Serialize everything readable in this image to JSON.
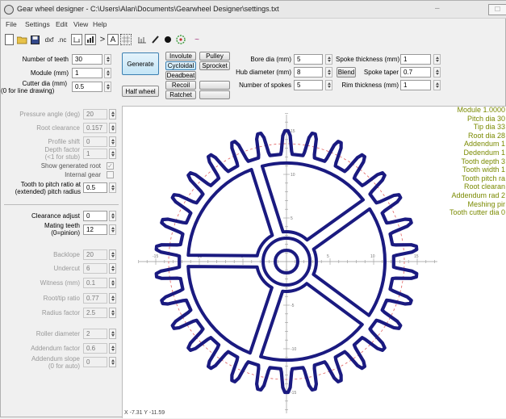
{
  "window": {
    "title": "Gear wheel designer - C:\\Users\\Alan\\Documents\\Gearwheel Designer\\settings.txt",
    "minimize": "–",
    "maximize": "□"
  },
  "menu": [
    "File",
    "Settings",
    "Edit",
    "View",
    "Help"
  ],
  "toolbar": {
    "dxf": "dxf",
    "nc": ".nc",
    "inv_tool": "A",
    "chart_icon": "~"
  },
  "top_left": {
    "teeth_label": "Number of teeth",
    "teeth_value": "30",
    "module_label": "Module (mm)",
    "module_value": "1",
    "cutter_label": "Cutter dia (mm)",
    "cutter_sub": "(0 for line drawing)",
    "cutter_value": "0.5"
  },
  "buttons": {
    "generate": "Generate",
    "half_wheel": "Half wheel",
    "involute": "Involute",
    "cycloidal": "Cycloidal",
    "deadbeat": "Deadbeat",
    "recoil": "Recoil",
    "ratchet": "Ratchet",
    "pulley": "Pulley",
    "sprocket": "Sprocket",
    "blend": "Blend"
  },
  "hub": {
    "bore_label": "Bore dia (mm)",
    "bore_value": "5",
    "hub_label": "Hub diameter (mm)",
    "hub_value": "8",
    "spokes_label": "Number of spokes",
    "spokes_value": "5",
    "spoke_thick_label": "Spoke thickness (mm)",
    "spoke_thick_value": "1",
    "spoke_taper_label": "Spoke taper",
    "spoke_taper_value": "0.7",
    "rim_label": "Rim thickness (mm)",
    "rim_value": "1"
  },
  "left_panel": {
    "pressure_label": "Pressure angle (deg)",
    "pressure_value": "20",
    "root_clear_label": "Root clearance",
    "root_clear_value": "0.157",
    "profile_label": "Profile shift",
    "profile_value": "0",
    "depth_label": "Depth factor",
    "depth_sub": "(<1 for stub)",
    "depth_value": "1",
    "show_root_label": "Show generated root",
    "internal_label": "Internal gear",
    "ratio_label": "Tooth to pitch ratio at",
    "ratio_sub": "(extended) pitch radius",
    "ratio_value": "0.5",
    "clearance_label": "Clearance adjust",
    "clearance_value": "0",
    "mating_label": "Mating teeth",
    "mating_sub": "(0=pinion)",
    "mating_value": "12",
    "backlope_label": "Backlope",
    "backlope_value": "20",
    "undercut_label": "Undercut",
    "undercut_value": "6",
    "witness_label": "Witness (mm)",
    "witness_value": "0.1",
    "roottip_label": "Root/tip ratio",
    "roottip_value": "0.77",
    "radius_label": "Radius factor",
    "radius_value": "2.5",
    "roller_label": "Roller diameter",
    "roller_value": "2",
    "addendum_factor_label": "Addendum factor",
    "addendum_factor_value": "0.6",
    "addendum_slope_label": "Addendum slope",
    "addendum_slope_sub": "(0 for auto)",
    "addendum_slope_value": "0"
  },
  "info_lines": [
    "Module 1.0000",
    "Pitch dia 30",
    "Tip dia 33",
    "Root dia 28",
    "Addendum 1",
    "Dedendum 1",
    "Tooth depth 3",
    "Tooth width 1",
    "Tooth pitch ra",
    "Root clearan",
    "Addendum rad 2",
    "Meshing pir",
    "Tooth cutter dia 0"
  ],
  "axis_ticks": {
    "x": [
      "-15",
      "-10",
      "-5",
      "5",
      "10",
      "15"
    ],
    "y": [
      "15",
      "10",
      "5",
      "-5",
      "-10",
      "-15"
    ]
  },
  "status": "X -7.31 Y -11.59",
  "colors": {
    "gear": "#1a1a80",
    "pitch_circle": "#e06060",
    "info_text": "#7a8a00"
  },
  "gear": {
    "teeth": 30,
    "spokes": 5
  }
}
